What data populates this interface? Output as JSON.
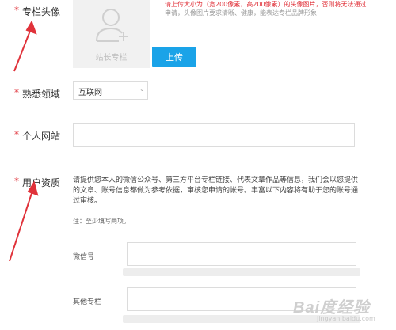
{
  "sections": {
    "avatar": {
      "required_mark": "*",
      "label": "专栏头像",
      "placeholder_caption": "站长专栏",
      "upload_label": "上传",
      "hint_red": "请上传大小为（宽200像素，高200像素）的头像图片，否则将无法通过",
      "hint_gray": "申请，头像图片要求清晰、健康，能表达专栏品牌形象"
    },
    "field_area": {
      "required_mark": "*",
      "label": "熟悉领域",
      "selected": "互联网",
      "arrow": "⌄"
    },
    "website": {
      "required_mark": "*",
      "label": "个人网站",
      "value": ""
    },
    "qualification": {
      "required_mark": "*",
      "label": "用户资质",
      "description": "请提供您本人的微信公众号、第三方平台专栏链接、代表文章作品等信息，我们会以您提供的文章、账号信息都做为参考依据，审核您申请的帐号。丰富以下内容将有助于您的账号通过审核。",
      "note": "注：至少填写两项。",
      "wechat_label": "微信号",
      "wechat_value": "",
      "other_label": "其他专栏",
      "other_value": ""
    }
  },
  "watermark": {
    "brand": "Bai度经验",
    "url": "jingyan.baidu.com"
  },
  "colors": {
    "required": "#e0323a",
    "accent": "#1aa3e8",
    "annotation_arrow": "#e0323a"
  }
}
